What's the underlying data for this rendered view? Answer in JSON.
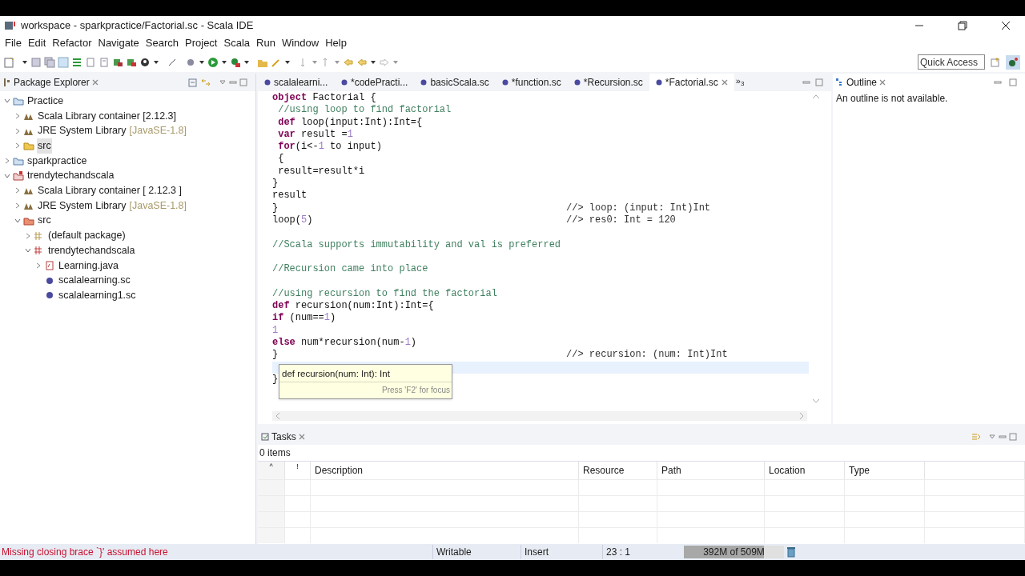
{
  "window": {
    "title": "workspace - sparkpractice/Factorial.sc - Scala IDE"
  },
  "menu": [
    "File",
    "Edit",
    "Refactor",
    "Navigate",
    "Search",
    "Project",
    "Scala",
    "Run",
    "Window",
    "Help"
  ],
  "quick_access": {
    "placeholder": "Quick Access"
  },
  "package_explorer": {
    "title": "Package Explorer",
    "tree": [
      {
        "label": "Practice",
        "kind": "project",
        "expanded": true,
        "selected": false,
        "children": [
          {
            "label": "Scala Library container [2.12.3]",
            "kind": "library",
            "expanded": false,
            "selected": false
          },
          {
            "label": "JRE System Library",
            "decoration": "[JavaSE-1.8]",
            "kind": "library",
            "expanded": false,
            "selected": false
          },
          {
            "label": "src",
            "kind": "folder",
            "expanded": false,
            "selected": true
          }
        ]
      },
      {
        "label": "sparkpractice",
        "kind": "project",
        "expanded": false,
        "selected": false
      },
      {
        "label": "trendytechandscala",
        "kind": "project-error",
        "expanded": true,
        "selected": false,
        "children": [
          {
            "label": "Scala Library container [ 2.12.3 ]",
            "kind": "library",
            "expanded": false,
            "selected": false
          },
          {
            "label": "JRE System Library",
            "decoration": "[JavaSE-1.8]",
            "kind": "library",
            "expanded": false,
            "selected": false
          },
          {
            "label": "src",
            "kind": "folder-error",
            "expanded": true,
            "selected": false,
            "children": [
              {
                "label": "(default package)",
                "kind": "package",
                "expanded": false,
                "selected": false
              },
              {
                "label": "trendytechandscala",
                "kind": "package-error",
                "expanded": true,
                "selected": false,
                "children": [
                  {
                    "label": "Learning.java",
                    "kind": "java-file",
                    "expanded": false,
                    "selected": false
                  },
                  {
                    "label": "scalalearning.sc",
                    "kind": "scala-file",
                    "selected": false
                  },
                  {
                    "label": "scalalearning1.sc",
                    "kind": "scala-file",
                    "selected": false
                  }
                ]
              }
            ]
          }
        ]
      }
    ]
  },
  "editor": {
    "tabs": [
      {
        "label": "scalalearni...",
        "selected": false
      },
      {
        "label": "*codePracti...",
        "selected": false
      },
      {
        "label": "basicScala.sc",
        "selected": false
      },
      {
        "label": "*function.sc",
        "selected": false
      },
      {
        "label": "*Recursion.sc",
        "selected": false
      },
      {
        "label": "*Factorial.sc",
        "selected": true
      }
    ],
    "overflow": "»",
    "overflow_count": "3",
    "lines": [
      {
        "current": false,
        "tokens": [
          {
            "kind": "keyword",
            "text": "object"
          },
          {
            "kind": "plain",
            "text": " Factorial {"
          }
        ]
      },
      {
        "current": false,
        "tokens": [
          {
            "kind": "comment",
            "text": " //using loop to find factorial"
          }
        ]
      },
      {
        "current": false,
        "tokens": [
          {
            "kind": "keyword",
            "text": " def"
          },
          {
            "kind": "plain",
            "text": " loop(input:Int):Int={"
          }
        ]
      },
      {
        "current": false,
        "tokens": [
          {
            "kind": "keyword",
            "text": " var"
          },
          {
            "kind": "plain",
            "text": " result ="
          },
          {
            "kind": "number",
            "text": "1"
          }
        ]
      },
      {
        "current": false,
        "tokens": [
          {
            "kind": "keyword",
            "text": " for"
          },
          {
            "kind": "plain",
            "text": "(i<-"
          },
          {
            "kind": "number",
            "text": "1"
          },
          {
            "kind": "plain",
            "text": " to input)"
          }
        ]
      },
      {
        "current": false,
        "tokens": [
          {
            "kind": "plain",
            "text": " {"
          }
        ]
      },
      {
        "current": false,
        "tokens": [
          {
            "kind": "plain",
            "text": " result=result*i"
          }
        ]
      },
      {
        "current": false,
        "tokens": [
          {
            "kind": "plain",
            "text": "}"
          }
        ]
      },
      {
        "current": false,
        "tokens": [
          {
            "kind": "plain",
            "text": "result"
          }
        ]
      },
      {
        "current": false,
        "tokens": [
          {
            "kind": "plain",
            "text": "}"
          }
        ],
        "result": "//> loop: (input: Int)Int"
      },
      {
        "current": false,
        "tokens": [
          {
            "kind": "plain",
            "text": "loop("
          },
          {
            "kind": "number",
            "text": "5"
          },
          {
            "kind": "plain",
            "text": ")"
          }
        ],
        "result": "//> res0: Int = 120"
      },
      {
        "current": false
      },
      {
        "current": false,
        "tokens": [
          {
            "kind": "comment",
            "text": "//Scala supports immutability and val is preferred"
          }
        ]
      },
      {
        "current": false
      },
      {
        "current": false,
        "tokens": [
          {
            "kind": "comment",
            "text": "//Recursion came into place"
          }
        ]
      },
      {
        "current": false
      },
      {
        "current": false,
        "tokens": [
          {
            "kind": "comment",
            "text": "//using recursion to find the factorial"
          }
        ]
      },
      {
        "current": false,
        "tokens": [
          {
            "kind": "keyword",
            "text": "def"
          },
          {
            "kind": "plain",
            "text": " recursion(num:Int):Int={"
          }
        ]
      },
      {
        "current": false,
        "tokens": [
          {
            "kind": "keyword",
            "text": "if"
          },
          {
            "kind": "plain",
            "text": " (num=="
          },
          {
            "kind": "number",
            "text": "1"
          },
          {
            "kind": "plain",
            "text": ")"
          }
        ]
      },
      {
        "current": false,
        "tokens": [
          {
            "kind": "number",
            "text": "1"
          }
        ]
      },
      {
        "current": false,
        "tokens": [
          {
            "kind": "keyword",
            "text": "else"
          },
          {
            "kind": "plain",
            "text": " num*recursion(num-"
          },
          {
            "kind": "number",
            "text": "1"
          },
          {
            "kind": "plain",
            "text": ")"
          }
        ]
      },
      {
        "current": false,
        "tokens": [
          {
            "kind": "plain",
            "text": "}"
          }
        ],
        "result": "//> recursion: (num: Int)Int"
      },
      {
        "current": true
      },
      {
        "current": false,
        "tokens": [
          {
            "kind": "plain",
            "text": "}"
          }
        ]
      }
    ],
    "tooltip": {
      "signature": "def recursion(num: Int): Int",
      "hint": "Press 'F2' for focus"
    }
  },
  "outline": {
    "title": "Outline",
    "message": "An outline is not available."
  },
  "tasks": {
    "title": "Tasks",
    "count": "0 items",
    "columns": [
      "^",
      "!",
      "Description",
      "Resource",
      "Path",
      "Location",
      "Type"
    ]
  },
  "status_bar": {
    "message": "Missing closing brace `}' assumed here",
    "writable": "Writable",
    "insert_mode": "Insert",
    "position": "23 : 1",
    "heap": {
      "text": "392M of 509M",
      "level": 0.8
    }
  }
}
